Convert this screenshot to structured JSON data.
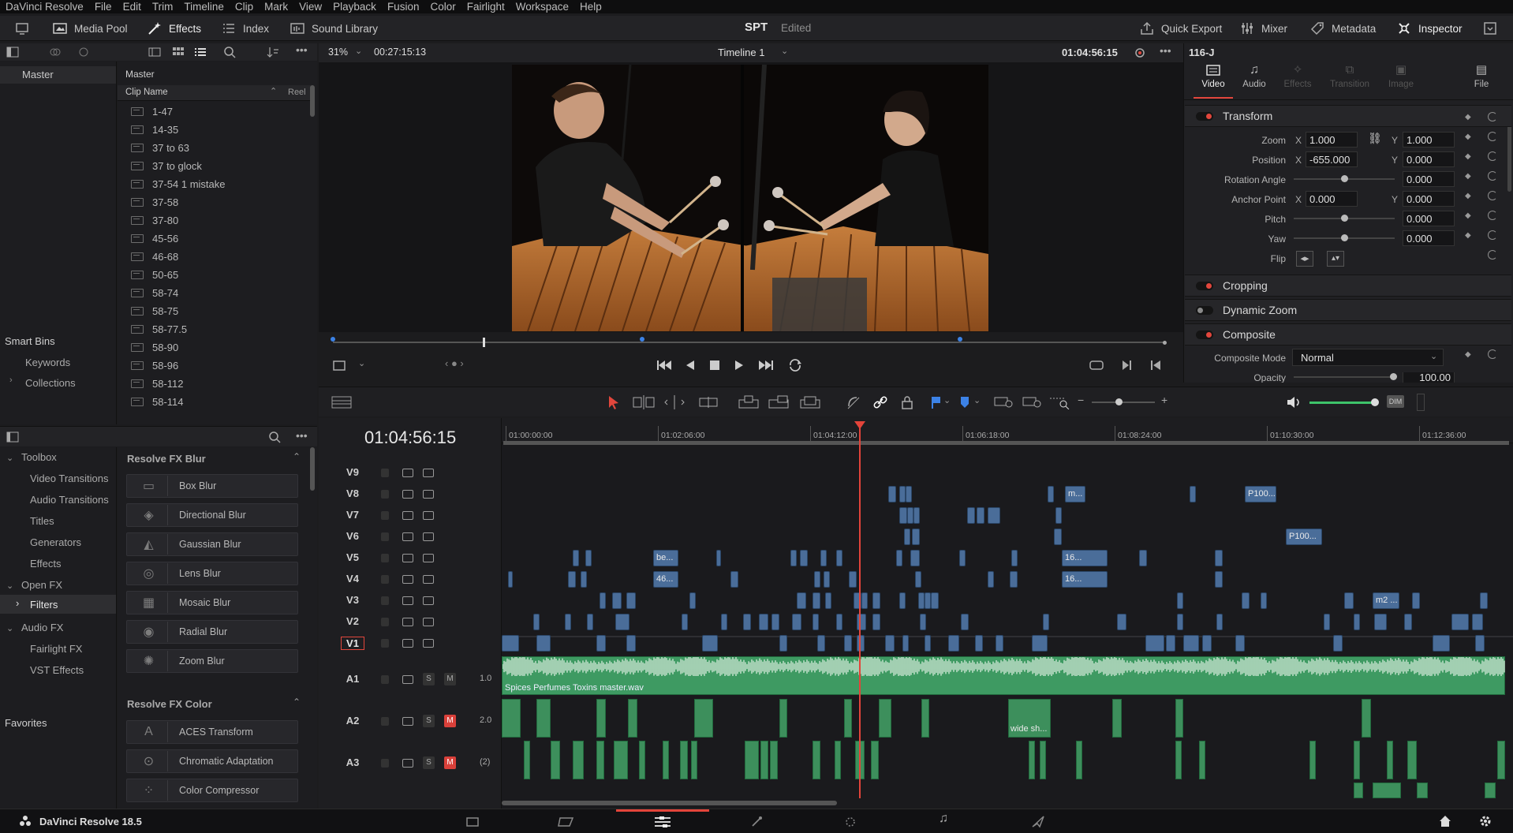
{
  "menu": [
    "DaVinci Resolve",
    "File",
    "Edit",
    "Trim",
    "Timeline",
    "Clip",
    "Mark",
    "View",
    "Playback",
    "Fusion",
    "Color",
    "Fairlight",
    "Workspace",
    "Help"
  ],
  "toolbar": {
    "media_pool": "Media Pool",
    "effects": "Effects",
    "index": "Index",
    "sound_library": "Sound Library",
    "project": "SPT",
    "status": "Edited",
    "quick_export": "Quick Export",
    "mixer": "Mixer",
    "metadata": "Metadata",
    "inspector": "Inspector"
  },
  "media_pool": {
    "zoom": "31%",
    "timecode": "00:27:15:13",
    "bin_root": "Master",
    "list_title": "Master",
    "col_clip_name": "Clip Name",
    "col_reel": "Reel",
    "clips": [
      "1-47",
      "14-35",
      "37 to 63",
      "37 to glock",
      "37-54 1 mistake",
      "37-58",
      "37-80",
      "45-56",
      "46-68",
      "50-65",
      "58-74",
      "58-75",
      "58-77.5",
      "58-90",
      "58-96",
      "58-112",
      "58-114"
    ],
    "smart_bins": "Smart Bins",
    "smart_items": [
      "Keywords",
      "Collections"
    ]
  },
  "viewer": {
    "timeline_name": "Timeline 1",
    "timecode": "01:04:56:15"
  },
  "inspector": {
    "clip_name": "116-J",
    "tabs": [
      "Video",
      "Audio",
      "Effects",
      "Transition",
      "Image",
      "File"
    ],
    "transform": "Transform",
    "zoom_label": "Zoom",
    "zoom_x": "1.000",
    "zoom_y": "1.000",
    "position_label": "Position",
    "position_x": "-655.000",
    "position_y": "0.000",
    "rotation_label": "Rotation Angle",
    "rotation": "0.000",
    "anchor_label": "Anchor Point",
    "anchor_x": "0.000",
    "anchor_y": "0.000",
    "pitch_label": "Pitch",
    "pitch": "0.000",
    "yaw_label": "Yaw",
    "yaw": "0.000",
    "flip_label": "Flip",
    "cropping": "Cropping",
    "dynamic_zoom": "Dynamic Zoom",
    "composite": "Composite",
    "composite_mode_label": "Composite Mode",
    "composite_mode": "Normal",
    "opacity_label": "Opacity",
    "opacity": "100.00",
    "x": "X",
    "y": "Y"
  },
  "effects": {
    "toolbox": "Toolbox",
    "items": [
      "Video Transitions",
      "Audio Transitions",
      "Titles",
      "Generators",
      "Effects"
    ],
    "open_fx": "Open FX",
    "filters": "Filters",
    "audio_fx": "Audio FX",
    "audio_items": [
      "Fairlight FX",
      "VST Effects"
    ],
    "favorites": "Favorites",
    "group1": "Resolve FX Blur",
    "blur": [
      "Box Blur",
      "Directional Blur",
      "Gaussian Blur",
      "Lens Blur",
      "Mosaic Blur",
      "Radial Blur",
      "Zoom Blur"
    ],
    "group2": "Resolve FX Color",
    "color": [
      "ACES Transform",
      "Chromatic Adaptation",
      "Color Compressor"
    ]
  },
  "timeline": {
    "timecode": "01:04:56:15",
    "ruler": [
      "01:00:00:00",
      "01:02:06:00",
      "01:04:12:00",
      "01:06:18:00",
      "01:08:24:00",
      "01:10:30:00",
      "01:12:36:00"
    ],
    "video_tracks": [
      "V9",
      "V8",
      "V7",
      "V6",
      "V5",
      "V4",
      "V3",
      "V2",
      "V1"
    ],
    "audio_tracks": [
      {
        "name": "A1",
        "level": "1.0"
      },
      {
        "name": "A2",
        "level": "2.0"
      },
      {
        "name": "A3",
        "level": "(2)"
      }
    ],
    "solo": "S",
    "mute": "M",
    "clip_labels": {
      "m": "m...",
      "p100a": "P100...",
      "p100b": "P100...",
      "be": "be...",
      "a16": "16...",
      "a46": "46...",
      "b16": "16...",
      "m2": "m2 ...",
      "master": "Spices Perfumes Toxins master.wav",
      "wide": "wide sh..."
    }
  },
  "bottom": {
    "app": "DaVinci Resolve 18.5"
  },
  "colors": {
    "accent_red": "#e2463c",
    "clip_blue": "#4a6d99",
    "audio_green": "#3d8f5c",
    "playhead": "#e3443a"
  }
}
